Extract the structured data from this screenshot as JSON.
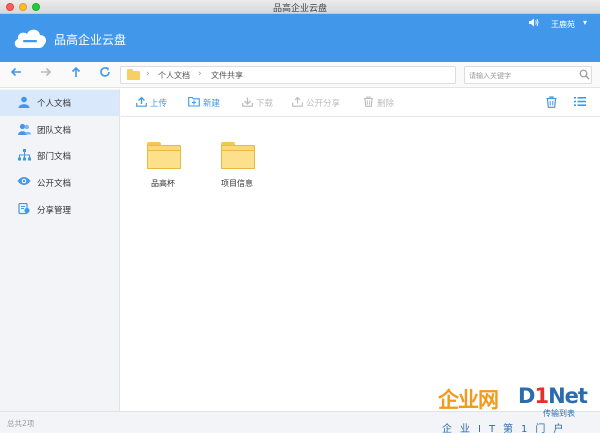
{
  "window": {
    "title": "品高企业云盘"
  },
  "header": {
    "app_name": "品高企业云盘",
    "user_name": "王鹿苑",
    "user_caret": "▾",
    "brand_color": "#4198ea"
  },
  "nav": {
    "back_icon": "back-arrow-icon",
    "forward_icon": "forward-arrow-icon",
    "up_icon": "up-arrow-icon",
    "refresh_icon": "refresh-icon",
    "breadcrumbs": [
      "个人文档",
      "文件共享"
    ],
    "search_placeholder": "请输入关键字"
  },
  "sidebar": {
    "items": [
      {
        "label": "个人文档",
        "icon": "person-icon",
        "active": true
      },
      {
        "label": "团队文档",
        "icon": "team-icon",
        "active": false
      },
      {
        "label": "部门文档",
        "icon": "org-chart-icon",
        "active": false
      },
      {
        "label": "公开文档",
        "icon": "eye-icon",
        "active": false
      },
      {
        "label": "分享管理",
        "icon": "share-manage-icon",
        "active": false
      }
    ]
  },
  "toolbar": {
    "upload_label": "上传",
    "new_label": "新建",
    "download_label": "下载",
    "public_share_label": "公开分享",
    "delete_label": "删除"
  },
  "files": [
    {
      "name": "品高杯",
      "type": "folder"
    },
    {
      "name": "项目信息",
      "type": "folder"
    }
  ],
  "status": {
    "text": "总共2项"
  },
  "watermark": {
    "cn": "企业网",
    "en_d": "D",
    "en_i": "1",
    "en_rest": "Net",
    "small": "传输到表",
    "sub": "企业IT第1门户"
  }
}
